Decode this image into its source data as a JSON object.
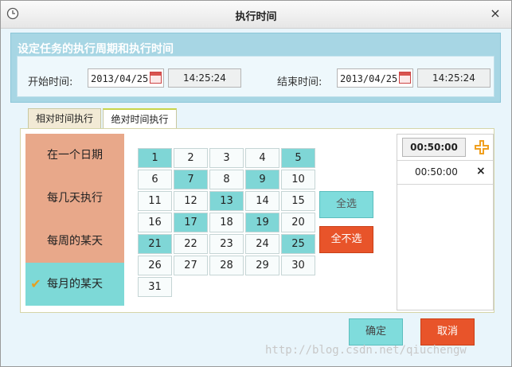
{
  "window": {
    "title": "执行时间",
    "close_icon": "×"
  },
  "settings": {
    "section_title": "设定任务的执行周期和执行时间",
    "start_label": "开始时间:",
    "start_date": "2013/04/25",
    "start_time": "14:25:24",
    "end_label": "结束时间:",
    "end_date": "2013/04/25",
    "end_time": "14:25:24"
  },
  "tabs": [
    {
      "label": "相对时间执行",
      "selected": false
    },
    {
      "label": "绝对时间执行",
      "selected": true
    }
  ],
  "options": [
    {
      "label": "在一个日期",
      "selected": false
    },
    {
      "label": "每几天执行",
      "selected": false
    },
    {
      "label": "每周的某天",
      "selected": false
    },
    {
      "label": "每月的某天",
      "selected": true
    }
  ],
  "days": [
    {
      "n": "1",
      "on": true
    },
    {
      "n": "2",
      "on": false
    },
    {
      "n": "3",
      "on": false
    },
    {
      "n": "4",
      "on": false
    },
    {
      "n": "5",
      "on": true
    },
    {
      "n": "6",
      "on": false
    },
    {
      "n": "7",
      "on": true
    },
    {
      "n": "8",
      "on": false
    },
    {
      "n": "9",
      "on": true
    },
    {
      "n": "10",
      "on": false
    },
    {
      "n": "11",
      "on": false
    },
    {
      "n": "12",
      "on": false
    },
    {
      "n": "13",
      "on": true
    },
    {
      "n": "14",
      "on": false
    },
    {
      "n": "15",
      "on": false
    },
    {
      "n": "16",
      "on": false
    },
    {
      "n": "17",
      "on": true
    },
    {
      "n": "18",
      "on": false
    },
    {
      "n": "19",
      "on": true
    },
    {
      "n": "20",
      "on": false
    },
    {
      "n": "21",
      "on": true
    },
    {
      "n": "22",
      "on": false
    },
    {
      "n": "23",
      "on": false
    },
    {
      "n": "24",
      "on": false
    },
    {
      "n": "25",
      "on": true
    },
    {
      "n": "26",
      "on": false
    },
    {
      "n": "27",
      "on": false
    },
    {
      "n": "28",
      "on": false
    },
    {
      "n": "29",
      "on": false
    },
    {
      "n": "30",
      "on": false
    },
    {
      "n": "31",
      "on": false
    }
  ],
  "buttons": {
    "select_all": "全选",
    "select_none": "全不选",
    "ok": "确定",
    "cancel": "取消"
  },
  "time_list": {
    "input_value": "00:50:00",
    "add_icon": "plus-icon",
    "items": [
      {
        "time": "00:50:00",
        "delete": "×"
      }
    ]
  },
  "colors": {
    "selected": "#7fd6d6",
    "option_bg": "#e8a88a",
    "danger": "#e8542a"
  },
  "watermark": "http://blog.csdn.net/qiuchengw"
}
